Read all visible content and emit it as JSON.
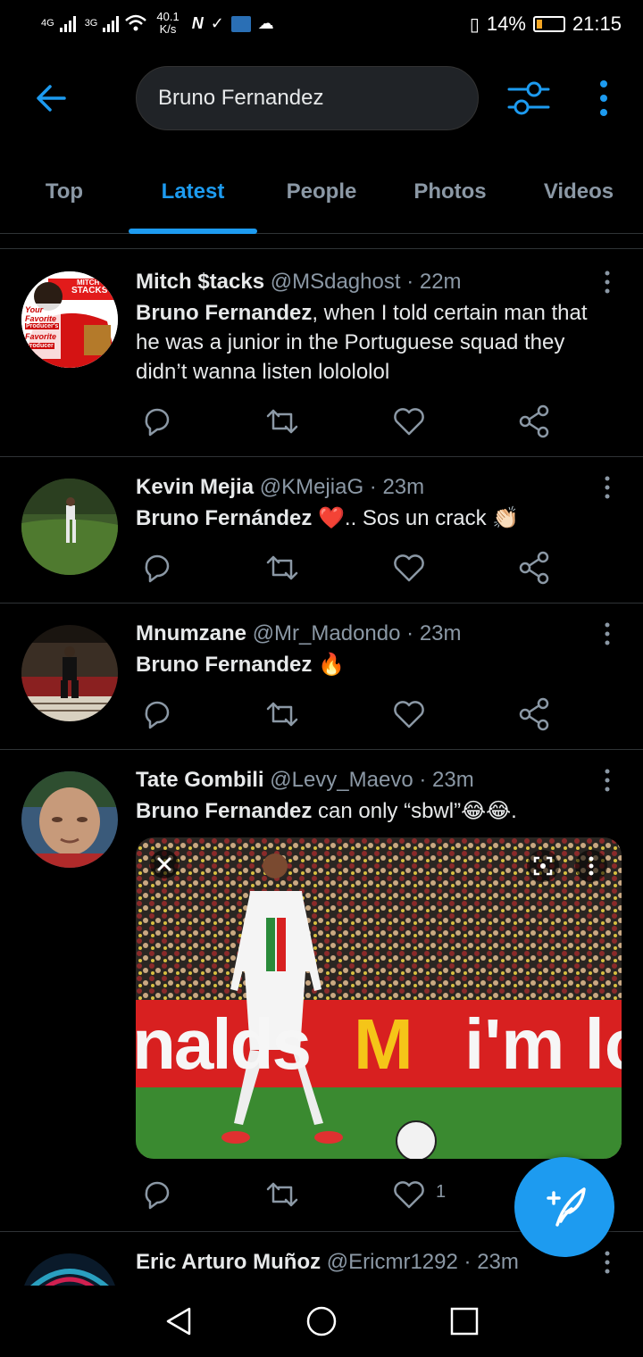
{
  "status_bar": {
    "network_1": "4G",
    "network_2": "3G",
    "speed_value": "40.1",
    "speed_unit": "K/s",
    "battery": "14%",
    "time": "21:15"
  },
  "header": {
    "search_value": "Bruno Fernandez",
    "accent_color": "#1d9bf0"
  },
  "tabs": [
    {
      "label": "Top",
      "active": false
    },
    {
      "label": "Latest",
      "active": true
    },
    {
      "label": "People",
      "active": false
    },
    {
      "label": "Photos",
      "active": false
    },
    {
      "label": "Videos",
      "active": false
    }
  ],
  "tweets": [
    {
      "name": "Mitch $tacks",
      "handle": "@MSdaghost",
      "time": "22m",
      "bold": "Bruno Fernandez",
      "text": ", when I told certain man that he was a junior in the Portuguese squad they didn’t wanna listen lolololol",
      "avatar_lines": [
        "MITCH",
        "STACKS",
        "Your",
        "Favorite",
        "Producer's",
        "Favorite",
        "Producer"
      ]
    },
    {
      "name": "Kevin Mejia",
      "handle": "@KMejiaG",
      "time": "23m",
      "bold": "Bruno Fernández",
      "text": " ❤️.. Sos un crack 👏🏻"
    },
    {
      "name": "Mnumzane",
      "handle": "@Mr_Madondo",
      "time": "23m",
      "bold": "Bruno Fernandez",
      "text": " 🔥"
    },
    {
      "name": "Tate Gombili",
      "handle": "@Levy_Maevo",
      "time": "23m",
      "bold": "Bruno Fernandez",
      "text": " can only “sbwl”😂😂.",
      "like_count": "1",
      "media_banner": [
        "nalds",
        "M",
        "i'm lo"
      ]
    },
    {
      "name": "Eric Arturo Muñoz",
      "handle": "@Ericmr1292",
      "time": "23m"
    }
  ]
}
